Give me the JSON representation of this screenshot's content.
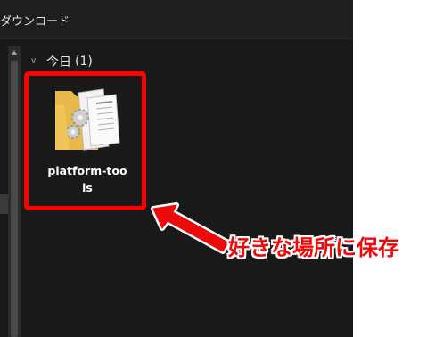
{
  "window": {
    "title": "ダウンロード"
  },
  "group": {
    "label": "今日",
    "count": "(1)"
  },
  "items": [
    {
      "name_line1": "platform-too",
      "name_line2": "ls",
      "icon": "folder-icon"
    }
  ],
  "annotation": {
    "text": "好きな場所に保存",
    "color": "#ff0000"
  }
}
